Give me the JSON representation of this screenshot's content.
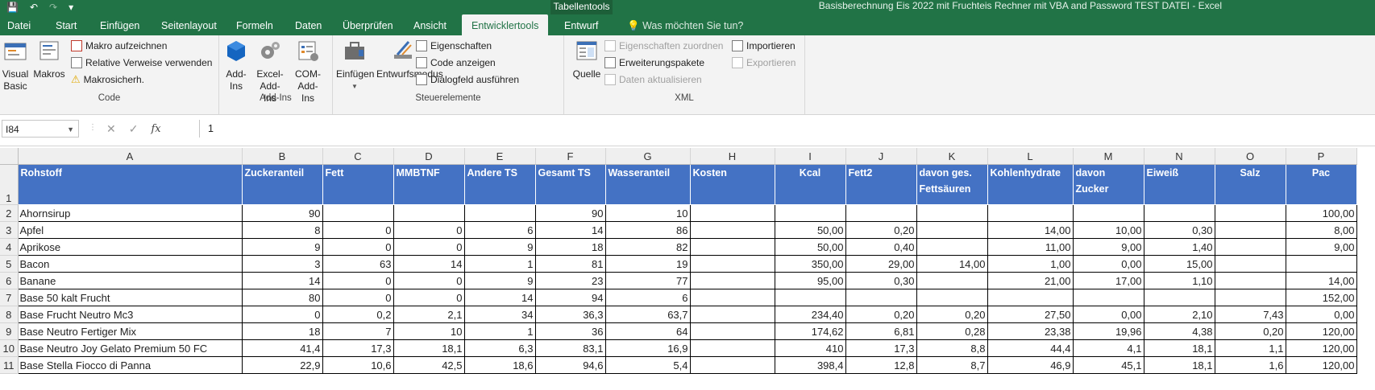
{
  "window": {
    "title": "Basisberechnung Eis 2022 mit Fruchteis Rechner mit VBA and Password TEST DATEI - Excel",
    "context_group": "Tabellentools"
  },
  "tabs": [
    "Datei",
    "Start",
    "Einfügen",
    "Seitenlayout",
    "Formeln",
    "Daten",
    "Überprüfen",
    "Ansicht",
    "Entwicklertools",
    "Entwurf"
  ],
  "tell_me": "Was möchten Sie tun?",
  "ribbon": {
    "code": {
      "label": "Code",
      "visual_basic": "Visual Basic",
      "makros": "Makros",
      "aufzeichnen": "Makro aufzeichnen",
      "relative": "Relative Verweise verwenden",
      "sicherheit": "Makrosicherh."
    },
    "addins": {
      "label": "Add-Ins",
      "addins": "Add-Ins",
      "excel_addins": "Excel-Add-Ins",
      "com_addins": "COM-Add-Ins"
    },
    "steuer": {
      "label": "Steuerelemente",
      "einfuegen": "Einfügen",
      "entwurfsmodus": "Entwurfsmodus",
      "eigenschaften": "Eigenschaften",
      "code_anzeigen": "Code anzeigen",
      "dialogfeld": "Dialogfeld ausführen"
    },
    "xml": {
      "label": "XML",
      "quelle": "Quelle",
      "eig_zuordnen": "Eigenschaften zuordnen",
      "erweiterung": "Erweiterungspakete",
      "aktualisieren": "Daten aktualisieren",
      "importieren": "Importieren",
      "exportieren": "Exportieren"
    }
  },
  "formula_bar": {
    "name_box": "I84",
    "value": "1"
  },
  "columns": [
    "A",
    "B",
    "C",
    "D",
    "E",
    "F",
    "G",
    "H",
    "I",
    "J",
    "K",
    "L",
    "M",
    "N",
    "O",
    "P"
  ],
  "header_row": [
    "Rohstoff",
    "Zuckeranteil",
    "Fett",
    "MMBTNF",
    "Andere TS",
    "Gesamt TS",
    "Wasseranteil",
    "Kosten",
    "Kcal",
    "Fett2",
    "davon ges. Fettsäuren",
    "Kohlenhydrate",
    "davon Zucker",
    "Eiweiß",
    "Salz",
    "Pac"
  ],
  "rows": [
    [
      "Ahornsirup",
      "90",
      "",
      "",
      "",
      "90",
      "10",
      "",
      "",
      "",
      "",
      "",
      "",
      "",
      "",
      "100,00"
    ],
    [
      "Apfel",
      "8",
      "0",
      "0",
      "6",
      "14",
      "86",
      "",
      "50,00",
      "0,20",
      "",
      "14,00",
      "10,00",
      "0,30",
      "",
      "8,00"
    ],
    [
      "Aprikose",
      "9",
      "0",
      "0",
      "9",
      "18",
      "82",
      "",
      "50,00",
      "0,40",
      "",
      "11,00",
      "9,00",
      "1,40",
      "",
      "9,00"
    ],
    [
      "Bacon",
      "3",
      "63",
      "14",
      "1",
      "81",
      "19",
      "",
      "350,00",
      "29,00",
      "14,00",
      "1,00",
      "0,00",
      "15,00",
      "",
      ""
    ],
    [
      "Banane",
      "14",
      "0",
      "0",
      "9",
      "23",
      "77",
      "",
      "95,00",
      "0,30",
      "",
      "21,00",
      "17,00",
      "1,10",
      "",
      "14,00"
    ],
    [
      "Base 50 kalt Frucht",
      "80",
      "0",
      "0",
      "14",
      "94",
      "6",
      "",
      "",
      "",
      "",
      "",
      "",
      "",
      "",
      "152,00"
    ],
    [
      "Base Frucht Neutro Mc3",
      "0",
      "0,2",
      "2,1",
      "34",
      "36,3",
      "63,7",
      "",
      "234,40",
      "0,20",
      "0,20",
      "27,50",
      "0,00",
      "2,10",
      "7,43",
      "0,00"
    ],
    [
      "Base Neutro Fertiger Mix",
      "18",
      "7",
      "10",
      "1",
      "36",
      "64",
      "",
      "174,62",
      "6,81",
      "0,28",
      "23,38",
      "19,96",
      "4,38",
      "0,20",
      "120,00"
    ],
    [
      "Base Neutro Joy Gelato Premium 50 FC",
      "41,4",
      "17,3",
      "18,1",
      "6,3",
      "83,1",
      "16,9",
      "",
      "410",
      "17,3",
      "8,8",
      "44,4",
      "4,1",
      "18,1",
      "1,1",
      "120,00"
    ],
    [
      "Base Stella Fiocco di Panna",
      "22,9",
      "10,6",
      "42,5",
      "18,6",
      "94,6",
      "5,4",
      "",
      "398,4",
      "12,8",
      "8,7",
      "46,9",
      "45,1",
      "18,1",
      "1,6",
      "120,00"
    ]
  ]
}
